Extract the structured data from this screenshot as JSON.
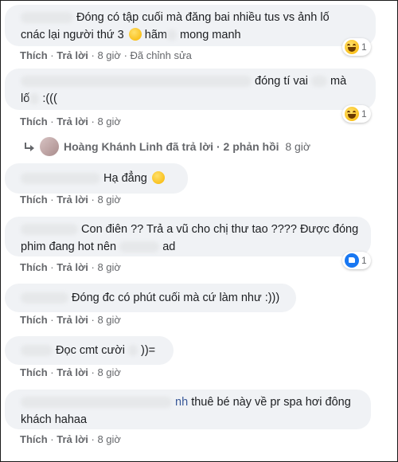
{
  "comments": [
    {
      "line1": "Đóng có tập cuối mà đăng bai nhiều tus vs ảnh lố",
      "line2a": "cnác lại người thứ 3",
      "line2b": "hãm",
      "line2c": "mong manh",
      "like": "Thích",
      "reply": "Trả lời",
      "time": "8 giờ",
      "edited": "Đã chỉnh sửa",
      "reaction_count": "1",
      "reaction_icon": "haha-emoji-icon"
    },
    {
      "line1a": "đóng tí vai",
      "line1b": "mà",
      "line2a": "lố",
      "line2b": ":(((",
      "like": "Thích",
      "reply": "Trả lời",
      "time": "8 giờ",
      "reaction_count": "1",
      "reaction_icon": "haha-emoji-icon"
    },
    {
      "line1": "Hạ đẳng",
      "like": "Thích",
      "reply": "Trả lời",
      "time": "8 giờ"
    },
    {
      "line1": "Con điên ?? Trả a vũ cho chị thư tao ???? Được đóng",
      "line2a": "phim đang hot nên",
      "line2b": "ad",
      "like": "Thích",
      "reply": "Trả lời",
      "time": "8 giờ",
      "reaction_count": "1",
      "reaction_icon": "like-icon"
    },
    {
      "line1": "Đóng đc có phút cuối mà cứ làm như :)))",
      "like": "Thích",
      "reply": "Trả lời",
      "time": "8 giờ"
    },
    {
      "line1a": "Đọc cmt cười",
      "line1b": "))=",
      "like": "Thích",
      "reply": "Trả lời",
      "time": "8 giờ"
    },
    {
      "line1a": "nh",
      "line1b": "thuê bé này về pr spa hơi đông",
      "line2": "khách hahaa",
      "like": "Thích",
      "reply": "Trả lời",
      "time": "8 giờ"
    }
  ],
  "replies_summary": {
    "name": "Hoàng Khánh Linh",
    "text": "đã trả lời",
    "count": "2 phản hồi",
    "time": "8 giờ"
  },
  "sep": "·"
}
